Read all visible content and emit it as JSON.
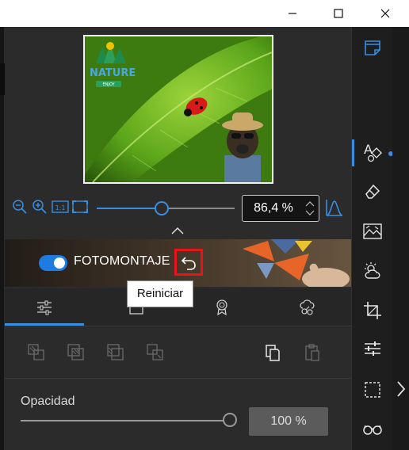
{
  "window": {
    "minimize_label": "Minimize",
    "maximize_label": "Maximize",
    "close_label": "Close"
  },
  "preview": {
    "logo_text": "NATURE",
    "logo_subtext": "ENJOY"
  },
  "zoom": {
    "value": "86,4 %",
    "slider_fraction": 0.47
  },
  "layer": {
    "toggle_on": true,
    "title": "FOTOMONTAJE",
    "tooltip": "Reiniciar"
  },
  "tabs": [
    {
      "icon": "sliders-icon",
      "active": true
    },
    {
      "icon": "image-frame-icon",
      "active": false
    },
    {
      "icon": "badge-icon",
      "active": false
    },
    {
      "icon": "effects-icon",
      "active": false
    }
  ],
  "arrange": {
    "buttons": [
      {
        "icon": "bring-to-front-icon",
        "enabled": false
      },
      {
        "icon": "bring-forward-icon",
        "enabled": false
      },
      {
        "icon": "send-backward-icon",
        "enabled": false
      },
      {
        "icon": "send-to-back-icon",
        "enabled": false
      },
      {
        "icon": "copy-icon",
        "enabled": true
      },
      {
        "icon": "paste-icon",
        "enabled": false
      }
    ]
  },
  "opacity": {
    "label": "Opacidad",
    "value": "100 %",
    "fraction": 1.0
  },
  "toolbar": {
    "tools": [
      "notes-edit-icon",
      "text-shapes-icon",
      "eraser-icon",
      "landscape-icon",
      "weather-icon",
      "crop-icon",
      "adjust-sliders-icon",
      "selection-icon",
      "glasses-icon"
    ]
  },
  "colors": {
    "accent": "#3a8ee0",
    "highlight_border": "#e8141a"
  }
}
